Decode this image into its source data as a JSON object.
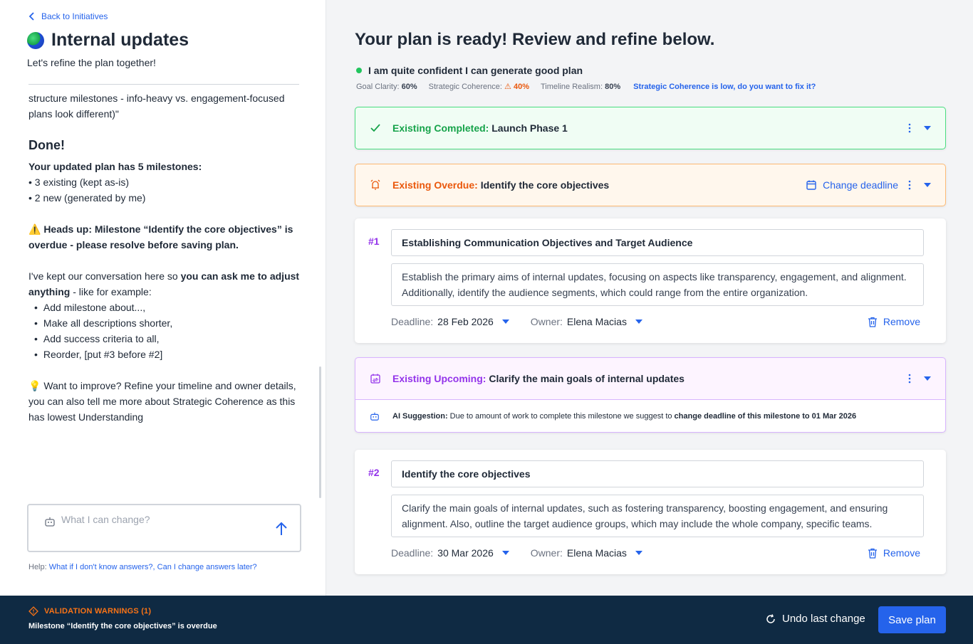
{
  "left": {
    "back_label": "Back to Initiatives",
    "title": "Internal updates",
    "subtitle": "Let's refine the plan together!",
    "chat": {
      "intro": "structure milestones - info-heavy vs. engagement-focused plans look different)\"",
      "done": "Done!",
      "plan_summary": "Your updated plan has 5 milestones:",
      "plan_items": [
        "3 existing (kept as-is)",
        "2 new (generated by me)"
      ],
      "heads_up": "⚠️ Heads up: Milestone “Identify the core objectives” is overdue - please resolve before saving plan.",
      "kept_prefix": "I've kept our conversation here so ",
      "kept_bold": "you can ask me to adjust anything",
      "kept_suffix": " - like for example:",
      "examples": [
        "Add milestone about...,",
        "Make all descriptions shorter,",
        "Add success criteria to all,",
        "Reorder, [put #3 before #2]"
      ],
      "improve": "💡 Want to improve? Refine your timeline and owner details, you can also tell me more about Strategic Coherence as this has lowest Understanding"
    },
    "input_placeholder": "What I can change?",
    "help_prefix": "Help: ",
    "help_link": "What if I don't know answers?, Can I change answers later?"
  },
  "right": {
    "title": "Your plan is ready! Review and refine below.",
    "confidence": "I am quite confident I can generate good plan",
    "metrics": {
      "goal_label": "Goal Clarity:",
      "goal_value": "60%",
      "strategic_label": "Strategic Coherence:",
      "strategic_value": "40%",
      "timeline_label": "Timeline Realism:",
      "timeline_value": "80%",
      "fix_link": "Strategic Coherence is low, do you want to fix it?"
    },
    "completed": {
      "tag": "Existing Completed:",
      "name": "Launch Phase 1"
    },
    "overdue": {
      "tag": "Existing Overdue:",
      "name": "Identify the core objectives",
      "action": "Change deadline"
    },
    "upcoming": {
      "tag": "Existing Upcoming:",
      "name": "Clarify the main goals of internal updates",
      "suggestion_label": "AI Suggestion:",
      "suggestion_text": " Due to amount of work to complete this milestone we suggest to ",
      "suggestion_bold": "change deadline of this milestone to 01 Mar 2026"
    },
    "milestones": [
      {
        "num": "#1",
        "title": "Establishing Communication Objectives and Target Audience",
        "description": "Establish the primary aims of internal updates, focusing on aspects like transparency, engagement, and alignment. Additionally, identify the audience segments, which could range from the entire organization.",
        "deadline_label": "Deadline:",
        "deadline": "28 Feb 2026",
        "owner_label": "Owner:",
        "owner": "Elena Macias",
        "remove": "Remove"
      },
      {
        "num": "#2",
        "title": "Identify the core objectives",
        "description": "Clarify the main goals of internal updates, such as fostering transparency, boosting engagement, and ensuring alignment. Also, outline the target audience groups, which may include the whole company, specific teams.",
        "deadline_label": "Deadline:",
        "deadline": "30 Mar 2026",
        "owner_label": "Owner:",
        "owner": "Elena Macias",
        "remove": "Remove"
      }
    ]
  },
  "footer": {
    "warnings_title": "VALIDATION WARNINGS (1)",
    "warning_message": "Milestone “Identify the core objectives” is overdue",
    "undo_label": "Undo last change",
    "save_label": "Save plan"
  },
  "colors": {
    "accent": "#2563eb",
    "completed": "#16a34a",
    "overdue": "#ea580c",
    "upcoming": "#9333ea",
    "footer_bg": "#0f2a43"
  },
  "icons": {
    "back": "chevron-left-icon",
    "globe": "globe-icon",
    "completed": "check-icon",
    "overdue": "alarm-icon",
    "calendar": "calendar-icon",
    "upcoming": "calendar-sync-icon",
    "ai": "robot-icon",
    "send": "arrow-up-icon",
    "remove": "trash-icon",
    "warning": "diamond-warning-icon",
    "undo": "refresh-icon"
  }
}
